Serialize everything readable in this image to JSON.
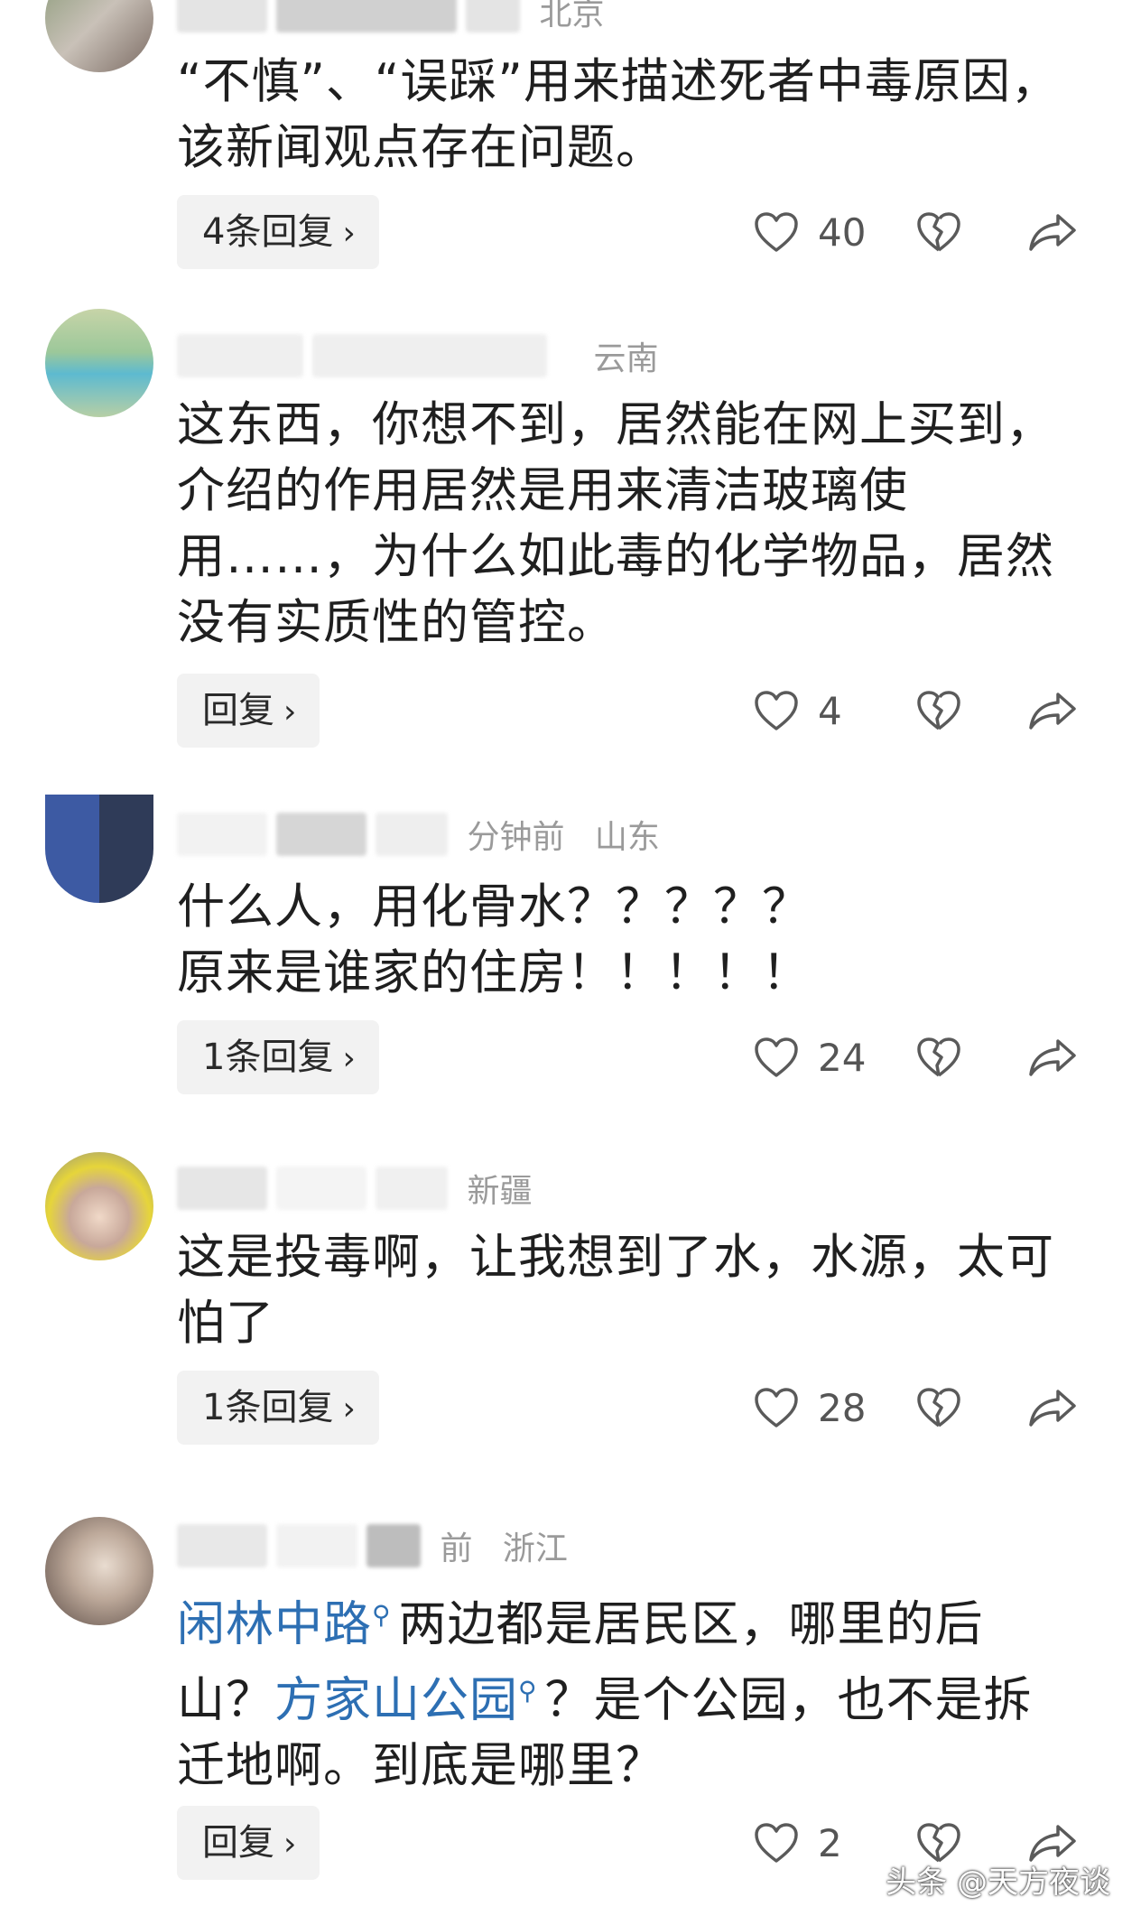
{
  "comments": [
    {
      "location": "北京",
      "text": [
        {
          "type": "text",
          "value": "“不慎”、“误踩”用来描述死者中毒原因，该新闻观点存在问题。"
        }
      ],
      "reply_label": "4条回复",
      "likes": "40"
    },
    {
      "location": "云南",
      "text": [
        {
          "type": "text",
          "value": "这东西，你想不到，居然能在网上买到，介绍的作用居然是用来清洁玻璃使用……，为什么如此毒的化学物品，居然没有实质性的管控。"
        }
      ],
      "reply_label": "回复",
      "likes": "4"
    },
    {
      "location": "山东",
      "time_suffix": "分钟前",
      "text": [
        {
          "type": "text",
          "value": "什么人，用化骨水？？？？？\n原来是谁家的住房！！！！！"
        }
      ],
      "reply_label": "1条回复",
      "likes": "24"
    },
    {
      "location": "新疆",
      "text": [
        {
          "type": "text",
          "value": "这是投毒啊，让我想到了水，水源，太可怕了"
        }
      ],
      "reply_label": "1条回复",
      "likes": "28"
    },
    {
      "location": "浙江",
      "time_suffix": "前",
      "text": [
        {
          "type": "link",
          "value": "闲林中路"
        },
        {
          "type": "text",
          "value": "两边都是居民区，哪里的后山？"
        },
        {
          "type": "link",
          "value": "方家山公园"
        },
        {
          "type": "text",
          "value": "？是个公园，也不是拆迁地啊。到底是哪里？"
        }
      ],
      "reply_label": "回复",
      "likes": "2"
    }
  ],
  "watermark": "头条 @天方夜谈",
  "icons": {
    "like": "heart-outline-icon",
    "dislike": "broken-heart-icon",
    "share": "share-arrow-icon",
    "chevron": "chevron-right-icon",
    "search": "search-icon"
  },
  "colors": {
    "link": "#2d6fb3",
    "meta": "#9a9a9a",
    "reply_bg": "#f2f2f2",
    "icon": "#5a5a5a"
  }
}
